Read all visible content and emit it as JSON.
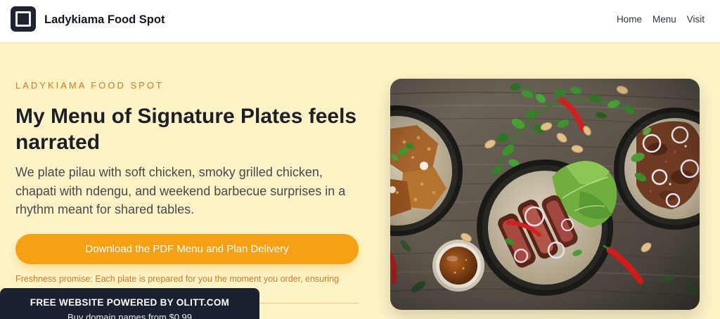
{
  "header": {
    "brand_name": "Ladykiama Food Spot",
    "logo_icon": "square-logo-icon",
    "nav": [
      {
        "label": "Home"
      },
      {
        "label": "Menu"
      },
      {
        "label": "Visit"
      }
    ]
  },
  "hero": {
    "eyebrow": "LADYKIAMA FOOD SPOT",
    "title": "My Menu of Signature Plates feels narrated",
    "description": "We plate pilau with soft chicken, smoky grilled chicken, chapati with ndengu, and weekend barbecue surprises in a rhythm meant for shared tables.",
    "cta_label": "Download the PDF Menu and Plan Delivery",
    "note": "Freshness promise: Each plate is prepared for you the moment you order, ensuring"
  },
  "promo_banner": {
    "title": "FREE WEBSITE POWERED BY OLITT.COM",
    "subtitle": "Buy domain names from $0.99"
  },
  "colors": {
    "page_background": "#fef3c7",
    "accent": "#f7a013",
    "accent_text": "#d97a1e",
    "banner": "#1a2232",
    "header": "#ffffff"
  }
}
